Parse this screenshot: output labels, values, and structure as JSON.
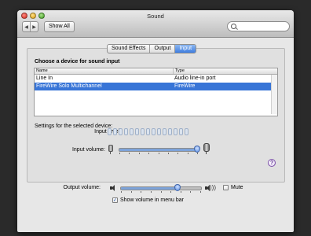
{
  "window": {
    "title": "Sound"
  },
  "toolbar": {
    "show_all": "Show All",
    "back_icon": "back-arrow-icon",
    "forward_icon": "forward-arrow-icon"
  },
  "search": {
    "placeholder": ""
  },
  "tabs": [
    {
      "label": "Sound Effects",
      "active": false
    },
    {
      "label": "Output",
      "active": false
    },
    {
      "label": "Input",
      "active": true
    }
  ],
  "input": {
    "heading": "Choose a device for sound input",
    "table": {
      "columns": [
        "Name",
        "Type"
      ],
      "rows": [
        {
          "name": "Line In",
          "type": "Audio line-in port",
          "selected": false
        },
        {
          "name": "FireWire Solo Multichannel",
          "type": "FireWire",
          "selected": true
        }
      ]
    },
    "settings_label": "Settings for the selected device:",
    "input_level_label": "Input level:",
    "input_level_segments": 15,
    "input_level_lit": 0,
    "input_volume_label": "Input volume:",
    "input_volume_fraction": 0.98
  },
  "output": {
    "volume_label": "Output volume:",
    "volume_fraction": 0.7,
    "mute_label": "Mute",
    "mute_checked": false,
    "show_volume_label": "Show volume in menu bar",
    "show_volume_checked": true
  },
  "colors": {
    "selection": "#3875d7",
    "tab_active": "#3f7ee0",
    "background": "#e7e7e7"
  }
}
